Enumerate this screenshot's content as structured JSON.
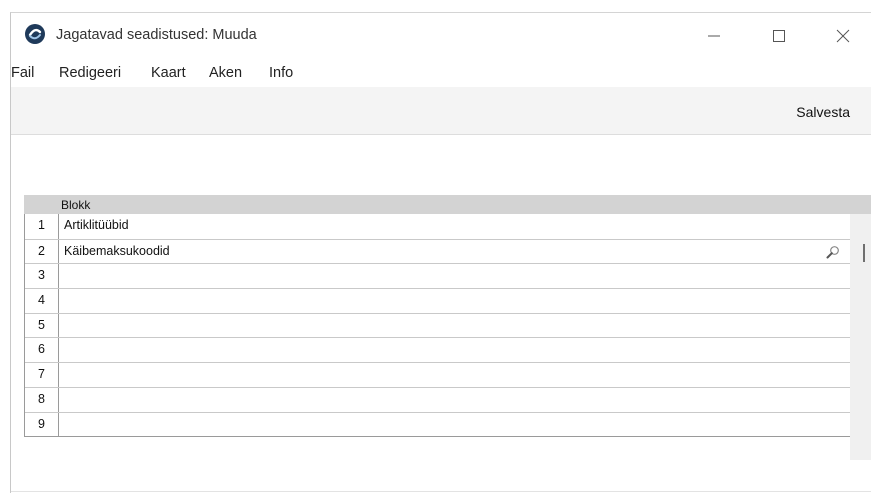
{
  "window": {
    "title": "Jagatavad seadistused: Muuda",
    "controls": [
      "minimize-icon",
      "maximize-icon",
      "close-icon"
    ]
  },
  "menu": {
    "items": [
      "Fail",
      "Redigeeri",
      "Kaart",
      "Aken",
      "Info"
    ]
  },
  "toolbar": {
    "save_label": "Salvesta"
  },
  "grid": {
    "column_header": "Blokk",
    "rows": [
      {
        "num": "1",
        "value": "Artiklitüübid"
      },
      {
        "num": "2",
        "value": "Käibemaksukoodid",
        "lookup": "magnifier-icon"
      },
      {
        "num": "3",
        "value": ""
      },
      {
        "num": "4",
        "value": ""
      },
      {
        "num": "5",
        "value": ""
      },
      {
        "num": "6",
        "value": ""
      },
      {
        "num": "7",
        "value": ""
      },
      {
        "num": "8",
        "value": ""
      },
      {
        "num": "9",
        "value": ""
      }
    ]
  },
  "colors": {
    "toolbar_bg": "#f4f4f4",
    "grid_header_bg": "#d3d3d3",
    "app_icon": "#1f3a5a"
  }
}
